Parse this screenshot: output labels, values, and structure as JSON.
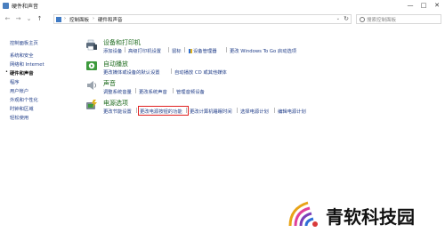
{
  "window": {
    "title": "硬件和声音"
  },
  "address": {
    "crumbs": [
      "控制面板",
      "硬件和声音"
    ]
  },
  "search": {
    "placeholder": "搜索控制面板"
  },
  "sidebar": {
    "items": [
      "控制面板主页",
      "系统和安全",
      "网络和 Internet",
      "硬件和声音",
      "程序",
      "用户帐户",
      "外观和个性化",
      "时钟和区域",
      "轻松使用"
    ],
    "current_index": 3
  },
  "sections": {
    "devices": {
      "title": "设备和打印机",
      "links": [
        "添加设备",
        "高级打印机设置",
        "鼠标",
        "设备管理器",
        "更改 Windows To Go 启动选项"
      ]
    },
    "autoplay": {
      "title": "自动播放",
      "links": [
        "更改媒体或设备的默认设置",
        "自动播放 CD 或其他媒体"
      ]
    },
    "sound": {
      "title": "声音",
      "links": [
        "调整系统音量",
        "更改系统声音",
        "管理音频设备"
      ]
    },
    "power": {
      "title": "电源选项",
      "links": [
        "更改节能设置",
        "更改电源按钮的功能",
        "更改计算机睡眠时间",
        "选择电源计划",
        "编辑电源计划"
      ]
    }
  },
  "watermark": {
    "text": "青软科技园"
  }
}
